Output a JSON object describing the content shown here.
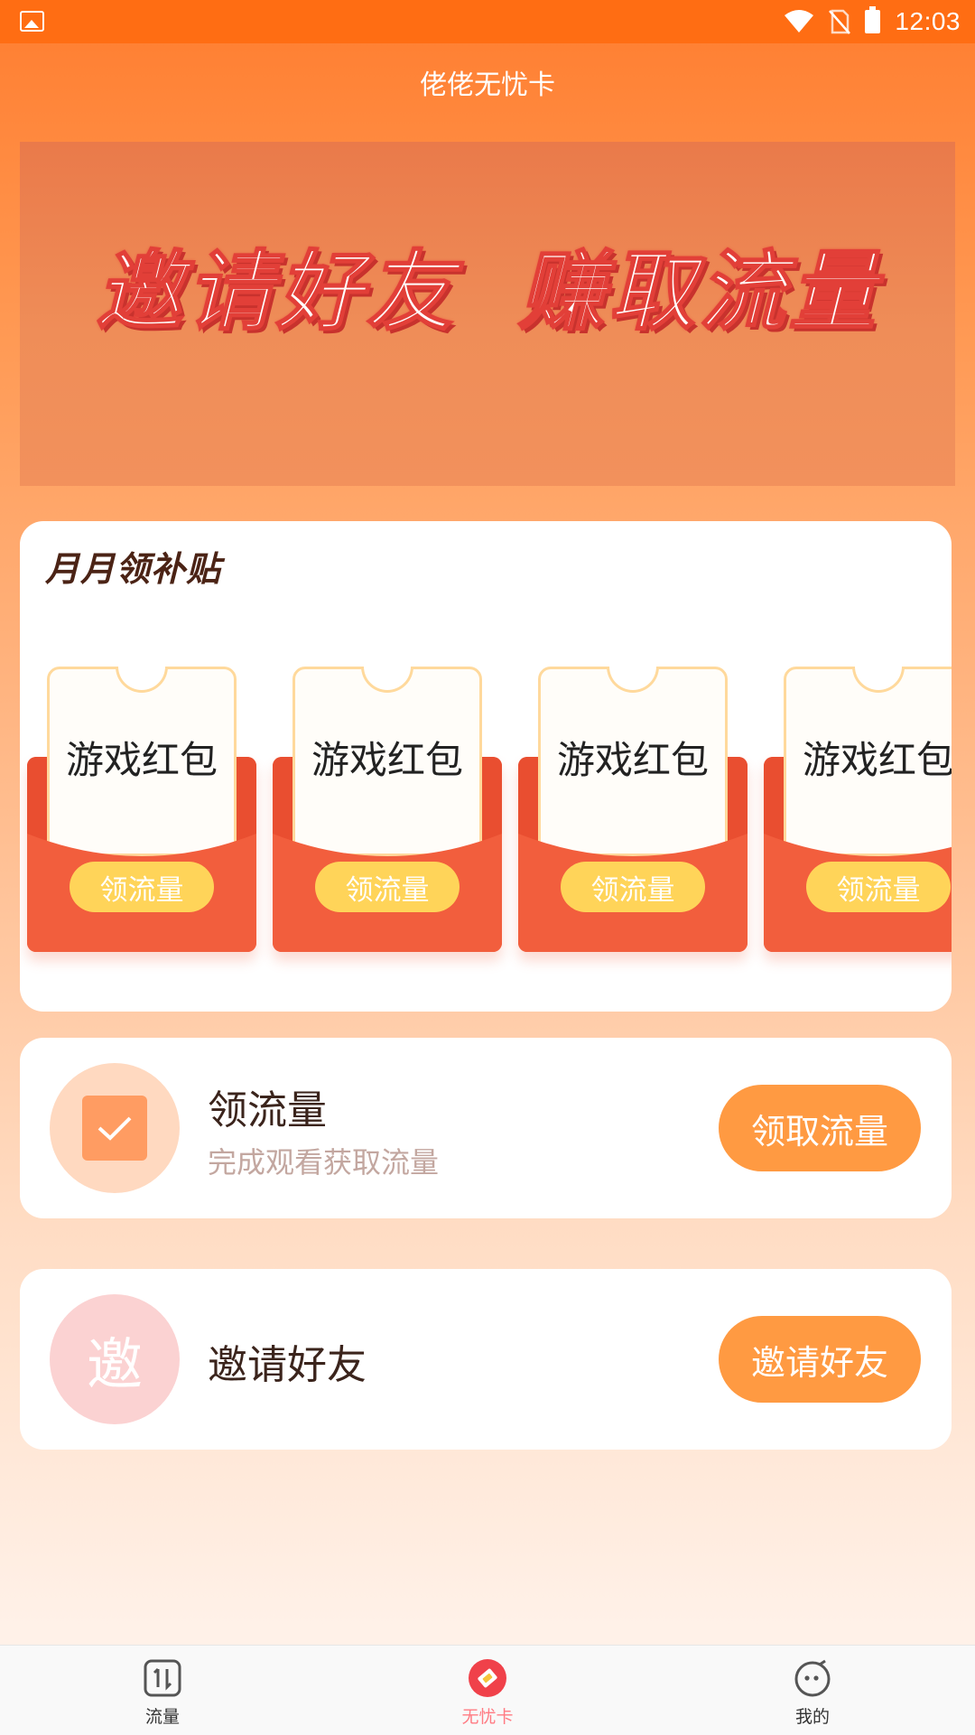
{
  "status_bar": {
    "time": "12:03"
  },
  "header": {
    "title": "佬佬无忧卡"
  },
  "banner": {
    "left": "邀请好友",
    "right": "赚取流量"
  },
  "subsidy": {
    "title": "月月领补贴",
    "items": [
      {
        "name": "游戏红包",
        "button": "领流量"
      },
      {
        "name": "游戏红包",
        "button": "领流量"
      },
      {
        "name": "游戏红包",
        "button": "领流量"
      },
      {
        "name": "游戏红包",
        "button": "领流量"
      }
    ]
  },
  "tasks": {
    "flow": {
      "title": "领流量",
      "subtitle": "完成观看获取流量",
      "button": "领取流量"
    },
    "invite": {
      "icon_char": "邀",
      "title": "邀请好友",
      "button": "邀请好友"
    }
  },
  "nav": [
    {
      "label": "流量",
      "icon": "traffic-icon"
    },
    {
      "label": "无忧卡",
      "icon": "card-icon",
      "active": true
    },
    {
      "label": "我的",
      "icon": "profile-face-icon"
    }
  ],
  "colors": {
    "accent": "#ff9a42",
    "status_bar": "#ff6d13",
    "nav_active": "#ff7b83",
    "packet_red": "#f05c3b",
    "pill_yellow": "#ffd459"
  }
}
